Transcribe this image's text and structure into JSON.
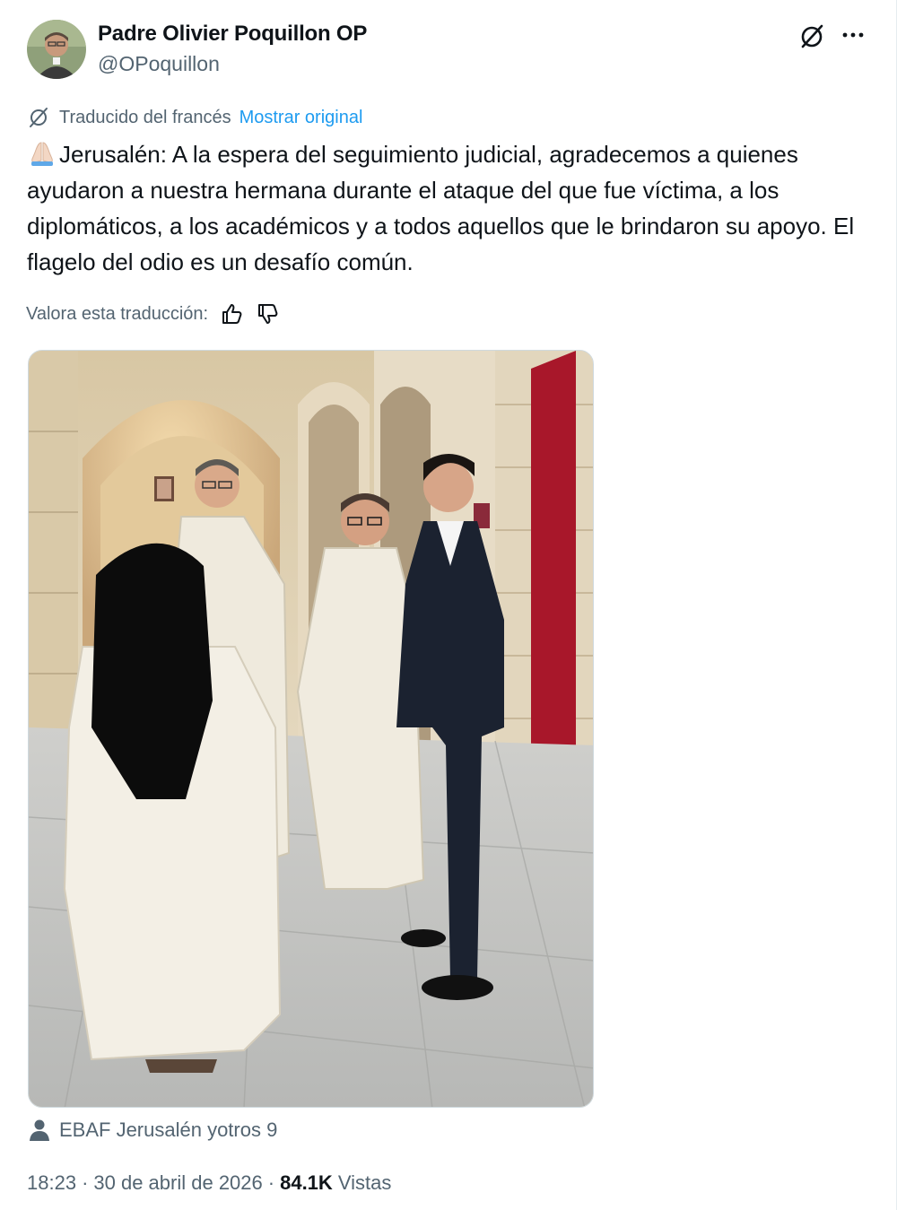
{
  "author": {
    "name": "Padre Olivier Poquillon OP",
    "handle": "@OPoquillon"
  },
  "translation": {
    "label": "Traducido del francés",
    "show_original": "Mostrar original"
  },
  "tweet": {
    "text": "Jerusalén: A la espera del seguimiento judicial, agradecemos a quienes ayudaron a nuestra hermana durante el ataque del que fue víctima, a los diplomáticos, a los académicos y a todos aquellos que le brindaron su apoyo. El flagelo del odio es un desafío común."
  },
  "rating": {
    "label": "Valora esta traducción:"
  },
  "tags": {
    "text": "EBAF Jerusalén yotros 9"
  },
  "meta": {
    "time": "18:23",
    "separator": "·",
    "date": "30 de abril de 2026",
    "views_count": "84.1K",
    "views_label": "Vistas"
  },
  "icons": {
    "grok": "grok-icon",
    "more": "more-icon",
    "translate": "translate-icon",
    "thumbs_up": "thumbs-up-icon",
    "thumbs_down": "thumbs-down-icon",
    "person": "person-icon",
    "praying_hands": "praying-hands-emoji"
  },
  "colors": {
    "text_primary": "#0f1419",
    "text_secondary": "#536471",
    "link": "#1d9bf0",
    "border": "#cfd9de"
  }
}
